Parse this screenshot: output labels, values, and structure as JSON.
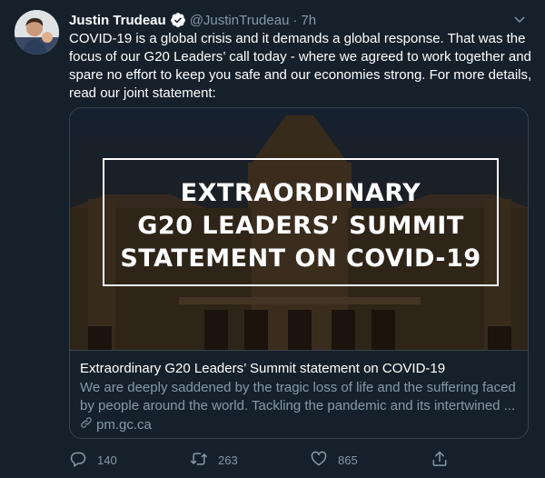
{
  "author": {
    "name": "Justin Trudeau",
    "handle": "@JustinTrudeau",
    "separator": "·",
    "time": "7h",
    "verified": true
  },
  "tweet": {
    "text": "COVID-19 is a global crisis and it demands a global response. That was the focus of our G20 Leaders’ call today - where we agreed to work together and spare no effort to keep you safe and our economies strong. For more details, read our joint statement:"
  },
  "card": {
    "image_lines": [
      "Extraordinary",
      "G20 Leaders’ Summit",
      "Statement on COVID-19"
    ],
    "title": "Extraordinary G20 Leaders’ Summit statement on COVID-19",
    "description": "We are deeply saddened by the tragic loss of life and the suffering faced by people around the world. Tackling the pandemic and its intertwined ...",
    "domain": "pm.gc.ca"
  },
  "actions": {
    "replies": "140",
    "retweets": "263",
    "likes": "865"
  },
  "colors": {
    "background": "#15202b",
    "text": "#ffffff",
    "secondary": "#8899a6",
    "border": "#38444d",
    "verified": "#ffffff"
  },
  "icons": [
    "verified-badge-icon",
    "chevron-down-icon",
    "link-icon",
    "reply-icon",
    "retweet-icon",
    "like-icon",
    "share-icon"
  ]
}
